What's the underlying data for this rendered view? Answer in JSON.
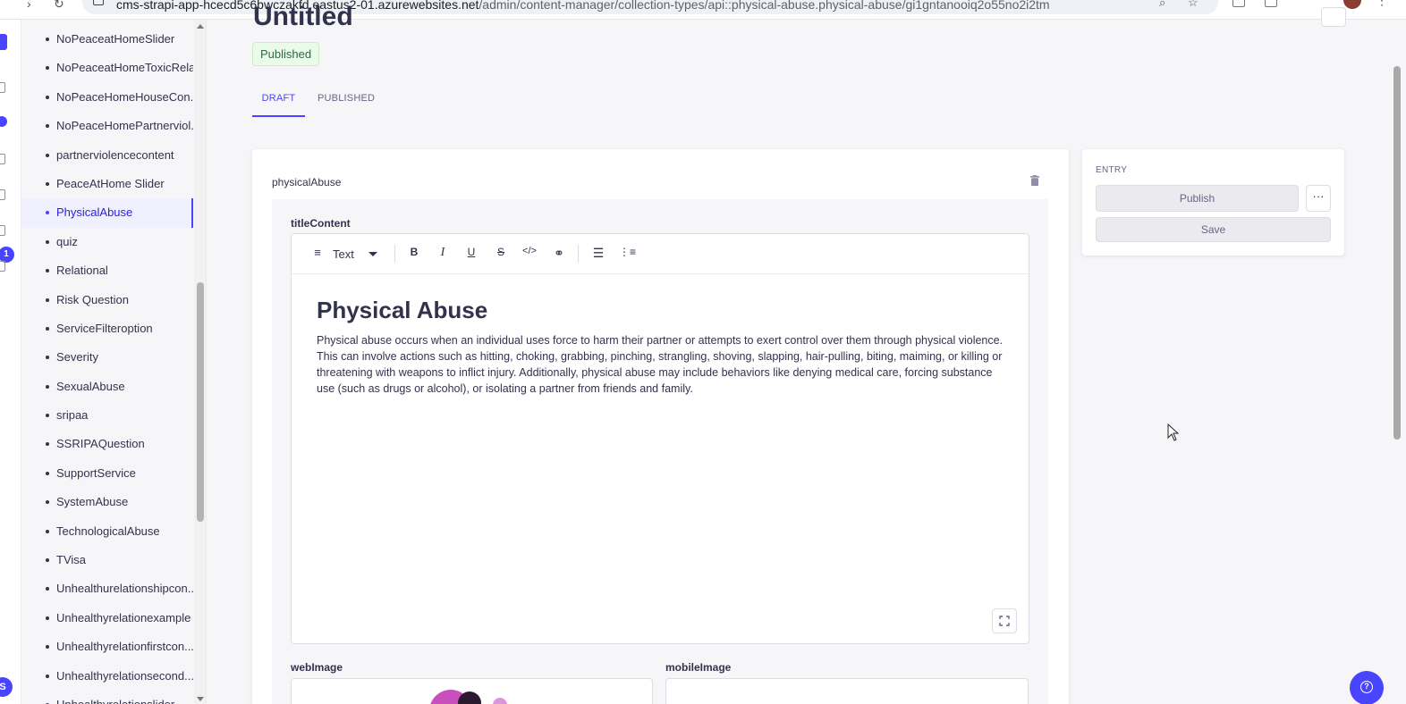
{
  "browser": {
    "url_prefix": "cms-strapi-app-hcecd5c6bwczakfd.eastus2-01.azurewebsites.net",
    "url_path": "/admin/content-manager/collection-types/api::physical-abuse.physical-abuse/gi1gntanooiq2o55no2i2tm"
  },
  "rail": {
    "badge": "1",
    "user_initial": "S"
  },
  "sidenav": {
    "items": [
      {
        "label": "NoPeaceatHomeSlider"
      },
      {
        "label": "NoPeaceatHomeToxicRela..."
      },
      {
        "label": "NoPeaceHomeHouseCon..."
      },
      {
        "label": "NoPeaceHomePartnerviol..."
      },
      {
        "label": "partnerviolencecontent"
      },
      {
        "label": "PeaceAtHome Slider"
      },
      {
        "label": "PhysicalAbuse",
        "active": true
      },
      {
        "label": "quiz"
      },
      {
        "label": "Relational"
      },
      {
        "label": "Risk Question"
      },
      {
        "label": "ServiceFilteroption"
      },
      {
        "label": "Severity"
      },
      {
        "label": "SexualAbuse"
      },
      {
        "label": "sripaa"
      },
      {
        "label": "SSRIPAQuestion"
      },
      {
        "label": "SupportService"
      },
      {
        "label": "SystemAbuse"
      },
      {
        "label": "TechnologicalAbuse"
      },
      {
        "label": "TVisa"
      },
      {
        "label": "Unhealthurelationshipcon..."
      },
      {
        "label": "Unhealthyrelationexample"
      },
      {
        "label": "Unhealthyrelationfirstcon..."
      },
      {
        "label": "Unhealthyrelationsecond..."
      },
      {
        "label": "Unhealthyrelationslider"
      }
    ]
  },
  "header": {
    "title": "Untitled",
    "status": "Published"
  },
  "tabs": [
    {
      "label": "DRAFT",
      "active": true
    },
    {
      "label": "PUBLISHED",
      "active": false
    }
  ],
  "component": {
    "name": "physicalAbuse",
    "title_field_label": "titleContent",
    "toolbar": {
      "block_type": "Text"
    },
    "content": {
      "heading": "Physical Abuse",
      "paragraph": "Physical abuse occurs when an individual uses force to harm their partner or attempts to exert control over them through physical violence.  This can involve actions such as hitting, choking, grabbing, pinching, strangling, shoving, slapping, hair-pulling, biting, maiming, or killing or threatening with weapons to inflict injury. Additionally, physical abuse may include behaviors like denying medical care, forcing substance use (such as drugs or alcohol), or isolating a partner from friends and family."
    },
    "web_image_label": "webImage",
    "mobile_image_label": "mobileImage"
  },
  "entry": {
    "label": "ENTRY",
    "publish": "Publish",
    "more": "···",
    "save": "Save"
  },
  "colors": {
    "primary": "#4945ff",
    "success_bg": "#eafbe7",
    "success_text": "#2f6846"
  }
}
